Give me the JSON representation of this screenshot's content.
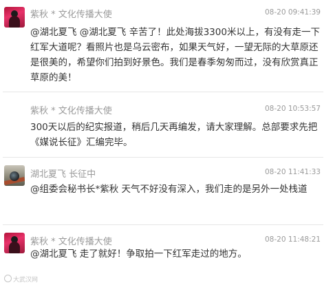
{
  "posts": [
    {
      "author": "紫秋 * 文化传播大使",
      "time": "08-20 09:41:39",
      "avatar_icon": "pink-portrait-avatar",
      "text": "@湖北夏飞 @湖北夏飞 辛苦了！此处海拔3300米以上，有没有走一下红军大道呢？看照片也是乌云密布，如果天气好，一望无际的大草原还是很美的，希望你们拍到好景色。我们是春季匆匆而过，没有欣赏真正草原的美！"
    },
    {
      "author": "紫秋 * 文化传播大使",
      "time": "08-20 10:53:57",
      "avatar_icon": "",
      "text": "300天以后的纪实报道，稍后几天再编发，请大家理解。总部要求先把《媒说长征》汇编完毕。"
    },
    {
      "author": "湖北夏飞 长征中",
      "time": "08-20 11:41:33",
      "avatar_icon": "camera-avatar",
      "text": "@组委会秘书长*紫秋 天气不好没有深入，我们走的是另外一处栈道"
    },
    {
      "author": "紫秋 * 文化传播大使",
      "time": "08-20 11:48:21",
      "avatar_icon": "pink-portrait-avatar",
      "text": "@湖北夏飞 走了就好！争取拍一下红军走过的地方。"
    }
  ],
  "watermark": "大武汉网"
}
